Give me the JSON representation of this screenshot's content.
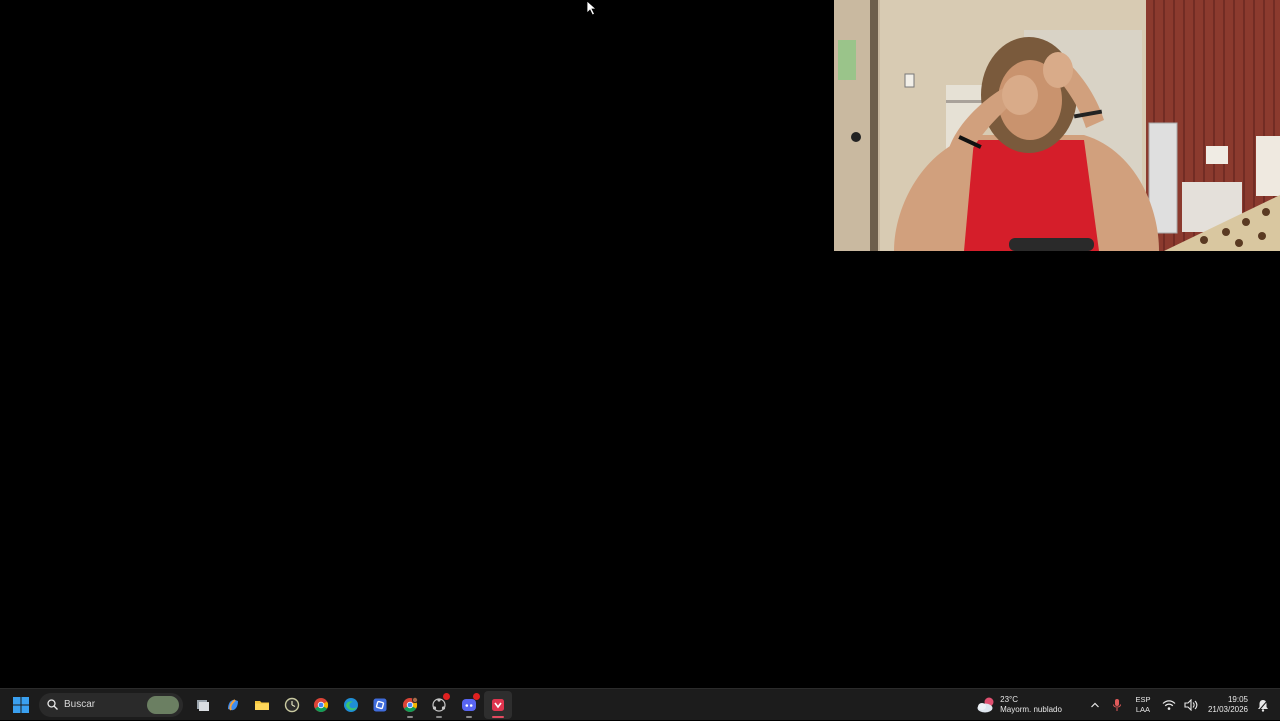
{
  "desktop": {
    "background": "#000000"
  },
  "webcam": {
    "description_icon": "webcam-overlay"
  },
  "taskbar": {
    "background": "#1c1c1c",
    "search": {
      "label": "Buscar"
    },
    "apps": [
      {
        "name": "task-view",
        "icon": "task-view-icon"
      },
      {
        "name": "copilot",
        "icon": "copilot-icon"
      },
      {
        "name": "file-explorer",
        "icon": "folder-icon"
      },
      {
        "name": "app-clock",
        "icon": "clock-app-icon"
      },
      {
        "name": "chrome",
        "icon": "chrome-icon"
      },
      {
        "name": "edge",
        "icon": "edge-icon"
      },
      {
        "name": "app-blue",
        "icon": "blue-app-icon"
      },
      {
        "name": "chrome-profile",
        "icon": "chrome-profile-icon"
      },
      {
        "name": "app-share",
        "icon": "share-icon"
      },
      {
        "name": "discord",
        "icon": "discord-icon"
      },
      {
        "name": "app-recorder",
        "icon": "recorder-icon"
      }
    ],
    "accent": "#e04a5f"
  },
  "tray": {
    "weather": {
      "temp": "23°C",
      "condition": "Mayorm. nublado",
      "badge": "1"
    },
    "language": {
      "line1": "ESP",
      "line2": "LAA"
    },
    "clock": {
      "time": "19:05",
      "date": "21/03/2026"
    }
  }
}
